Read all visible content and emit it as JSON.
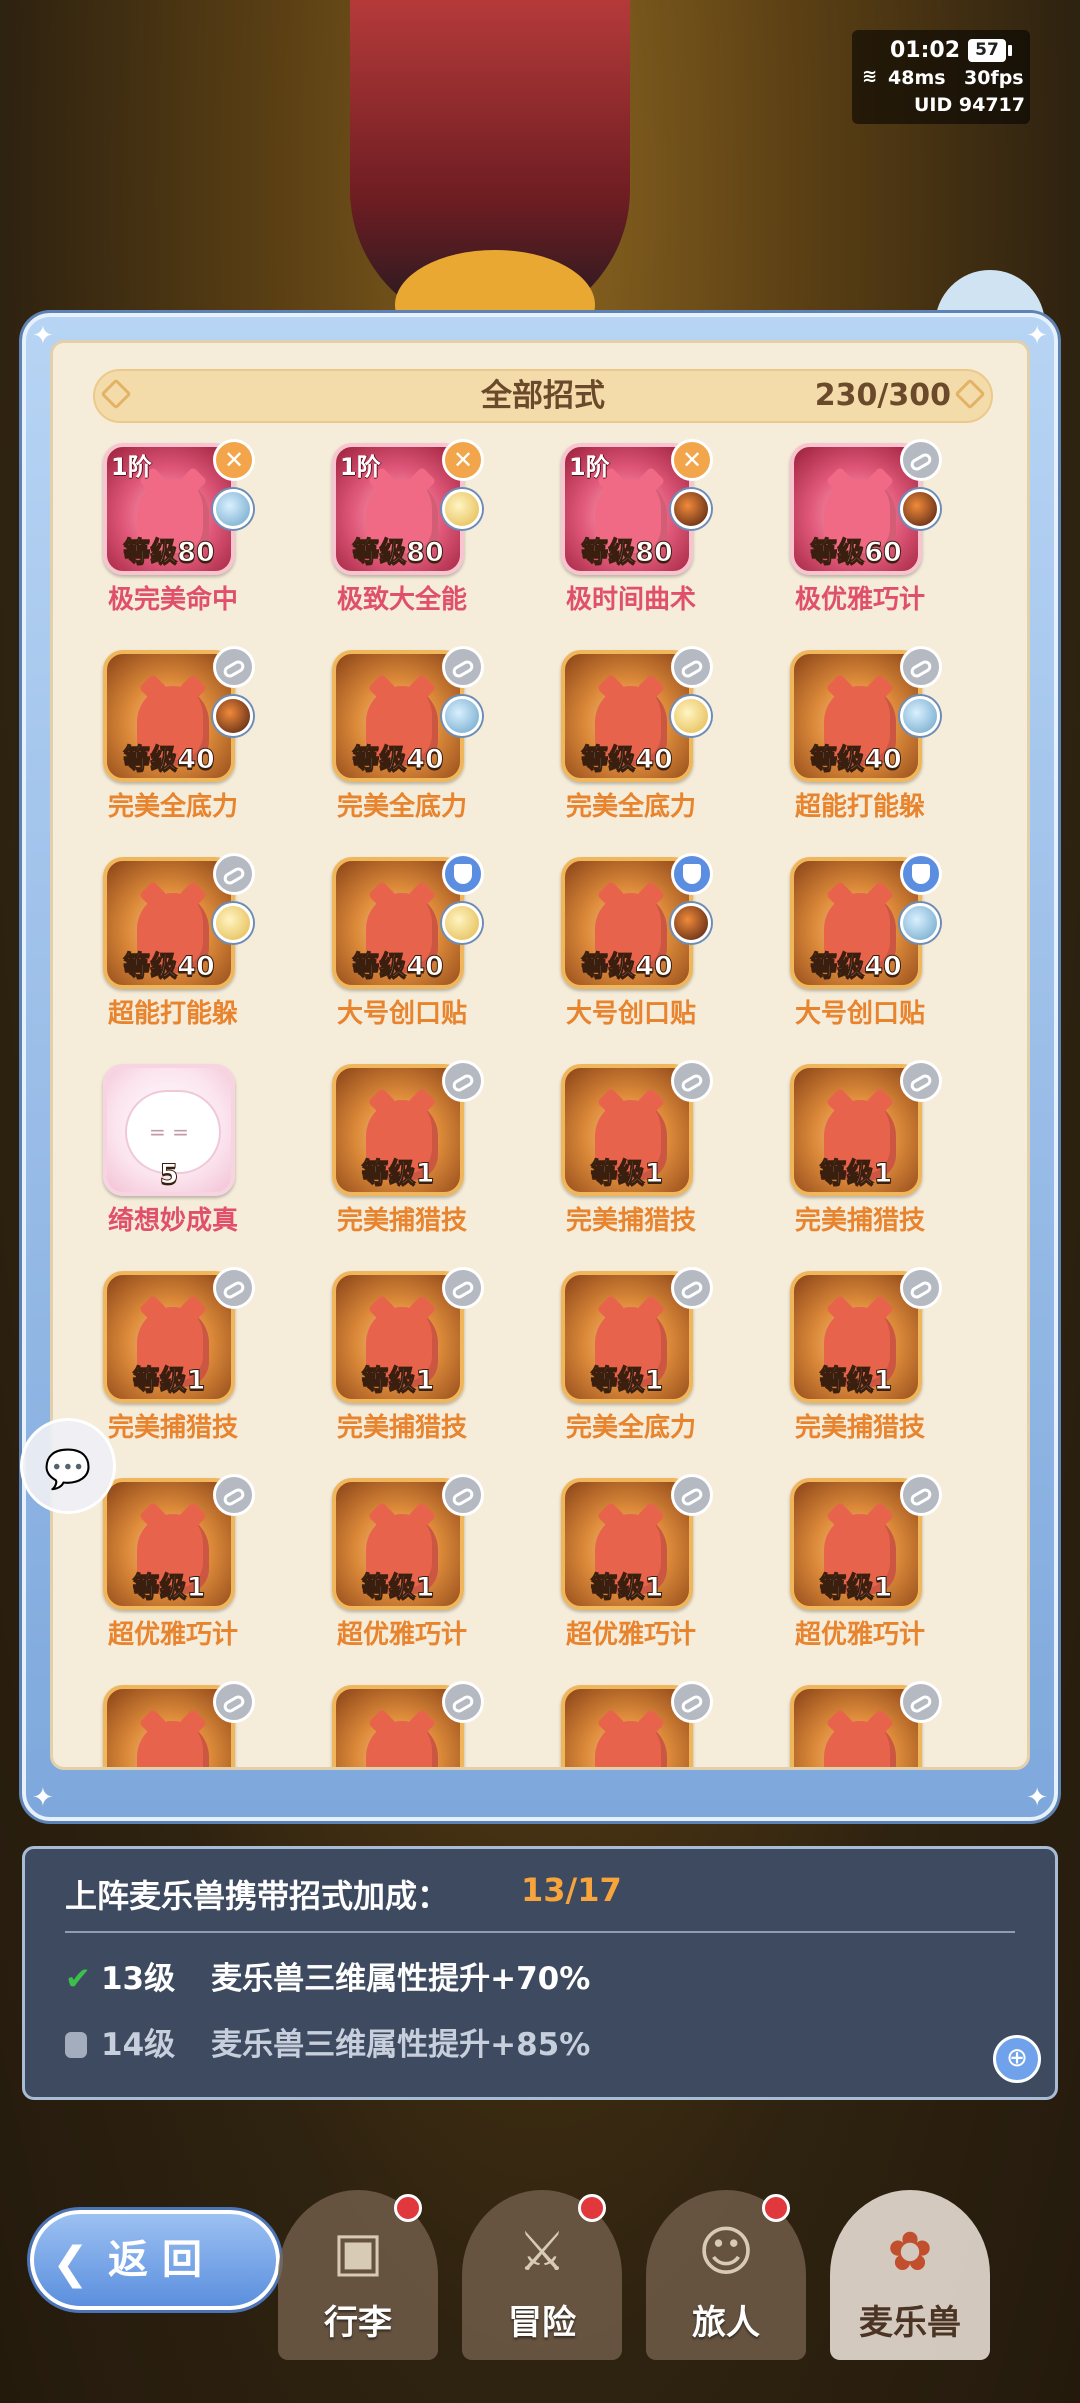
{
  "status": {
    "time": "01:02",
    "battery": "57",
    "ping": "48ms",
    "fps": "30fps",
    "uid": "UID 94717"
  },
  "panel": {
    "title": "全部招式",
    "count": "230/300"
  },
  "skills": [
    {
      "rank": "1阶",
      "level": "等级80",
      "name": "极完美命中",
      "tile": "pink",
      "badge": "x",
      "avatar": "blue",
      "color": "pink"
    },
    {
      "rank": "1阶",
      "level": "等级80",
      "name": "极致大全能",
      "tile": "pink",
      "badge": "x",
      "avatar": "yellow",
      "color": "pink"
    },
    {
      "rank": "1阶",
      "level": "等级80",
      "name": "极时间曲术",
      "tile": "pink",
      "badge": "x",
      "avatar": "dark",
      "color": "pink"
    },
    {
      "rank": "",
      "level": "等级60",
      "name": "极优雅巧计",
      "tile": "pink",
      "badge": "link",
      "avatar": "dark",
      "color": "pink"
    },
    {
      "rank": "",
      "level": "等级40",
      "name": "完美全底力",
      "tile": "gold",
      "badge": "link",
      "avatar": "dark",
      "color": "orange"
    },
    {
      "rank": "",
      "level": "等级40",
      "name": "完美全底力",
      "tile": "gold",
      "badge": "link",
      "avatar": "blue",
      "color": "orange"
    },
    {
      "rank": "",
      "level": "等级40",
      "name": "完美全底力",
      "tile": "gold",
      "badge": "link",
      "avatar": "yellow",
      "color": "orange"
    },
    {
      "rank": "",
      "level": "等级40",
      "name": "超能打能躲",
      "tile": "gold",
      "badge": "link",
      "avatar": "blue",
      "color": "orange"
    },
    {
      "rank": "",
      "level": "等级40",
      "name": "超能打能躲",
      "tile": "gold",
      "badge": "link",
      "avatar": "yellow",
      "color": "orange"
    },
    {
      "rank": "",
      "level": "等级40",
      "name": "大号创口贴",
      "tile": "gold",
      "badge": "shield",
      "avatar": "yellow",
      "color": "orange"
    },
    {
      "rank": "",
      "level": "等级40",
      "name": "大号创口贴",
      "tile": "gold",
      "badge": "shield",
      "avatar": "dark",
      "color": "orange"
    },
    {
      "rank": "",
      "level": "等级40",
      "name": "大号创口贴",
      "tile": "gold",
      "badge": "shield",
      "avatar": "blue",
      "color": "orange"
    },
    {
      "rank": "",
      "level": "5",
      "name": "绮想妙成真",
      "tile": "white",
      "badge": "",
      "avatar": "",
      "color": "pink"
    },
    {
      "rank": "",
      "level": "等级1",
      "name": "完美捕猎技",
      "tile": "gold",
      "badge": "link",
      "avatar": "",
      "color": "orange"
    },
    {
      "rank": "",
      "level": "等级1",
      "name": "完美捕猎技",
      "tile": "gold",
      "badge": "link",
      "avatar": "",
      "color": "orange"
    },
    {
      "rank": "",
      "level": "等级1",
      "name": "完美捕猎技",
      "tile": "gold",
      "badge": "link",
      "avatar": "",
      "color": "orange"
    },
    {
      "rank": "",
      "level": "等级1",
      "name": "完美捕猎技",
      "tile": "gold",
      "badge": "link",
      "avatar": "",
      "color": "orange"
    },
    {
      "rank": "",
      "level": "等级1",
      "name": "完美捕猎技",
      "tile": "gold",
      "badge": "link",
      "avatar": "",
      "color": "orange"
    },
    {
      "rank": "",
      "level": "等级1",
      "name": "完美全底力",
      "tile": "gold",
      "badge": "link",
      "avatar": "",
      "color": "orange"
    },
    {
      "rank": "",
      "level": "等级1",
      "name": "完美捕猎技",
      "tile": "gold",
      "badge": "link",
      "avatar": "",
      "color": "orange"
    },
    {
      "rank": "",
      "level": "等级1",
      "name": "超优雅巧计",
      "tile": "gold",
      "badge": "link",
      "avatar": "",
      "color": "orange"
    },
    {
      "rank": "",
      "level": "等级1",
      "name": "超优雅巧计",
      "tile": "gold",
      "badge": "link",
      "avatar": "",
      "color": "orange"
    },
    {
      "rank": "",
      "level": "等级1",
      "name": "超优雅巧计",
      "tile": "gold",
      "badge": "link",
      "avatar": "",
      "color": "orange"
    },
    {
      "rank": "",
      "level": "等级1",
      "name": "超优雅巧计",
      "tile": "gold",
      "badge": "link",
      "avatar": "",
      "color": "orange"
    },
    {
      "rank": "",
      "level": "",
      "name": "",
      "tile": "gold",
      "badge": "link",
      "avatar": "",
      "color": "orange"
    },
    {
      "rank": "",
      "level": "",
      "name": "",
      "tile": "gold",
      "badge": "link",
      "avatar": "",
      "color": "orange"
    },
    {
      "rank": "",
      "level": "",
      "name": "",
      "tile": "gold",
      "badge": "link",
      "avatar": "",
      "color": "orange"
    },
    {
      "rank": "",
      "level": "",
      "name": "",
      "tile": "gold",
      "badge": "link",
      "avatar": "",
      "color": "orange"
    }
  ],
  "bonus": {
    "title": "上阵麦乐兽携带招式加成：",
    "value": "13/17",
    "row1_level": "13级",
    "row1_text": "麦乐兽三维属性提升+70%",
    "row2_level": "14级",
    "row2_text": "麦乐兽三维属性提升+85%"
  },
  "back_label": "返 回",
  "nav": [
    {
      "label": "行李",
      "icon": "bag-icon"
    },
    {
      "label": "冒险",
      "icon": "crossed-swords-icon"
    },
    {
      "label": "旅人",
      "icon": "traveler-icon"
    },
    {
      "label": "麦乐兽",
      "icon": "fox-icon"
    }
  ],
  "colors": {
    "accent": "#f6a43b",
    "frame": "#7ea8dc",
    "panel": "#f5ecd9"
  }
}
